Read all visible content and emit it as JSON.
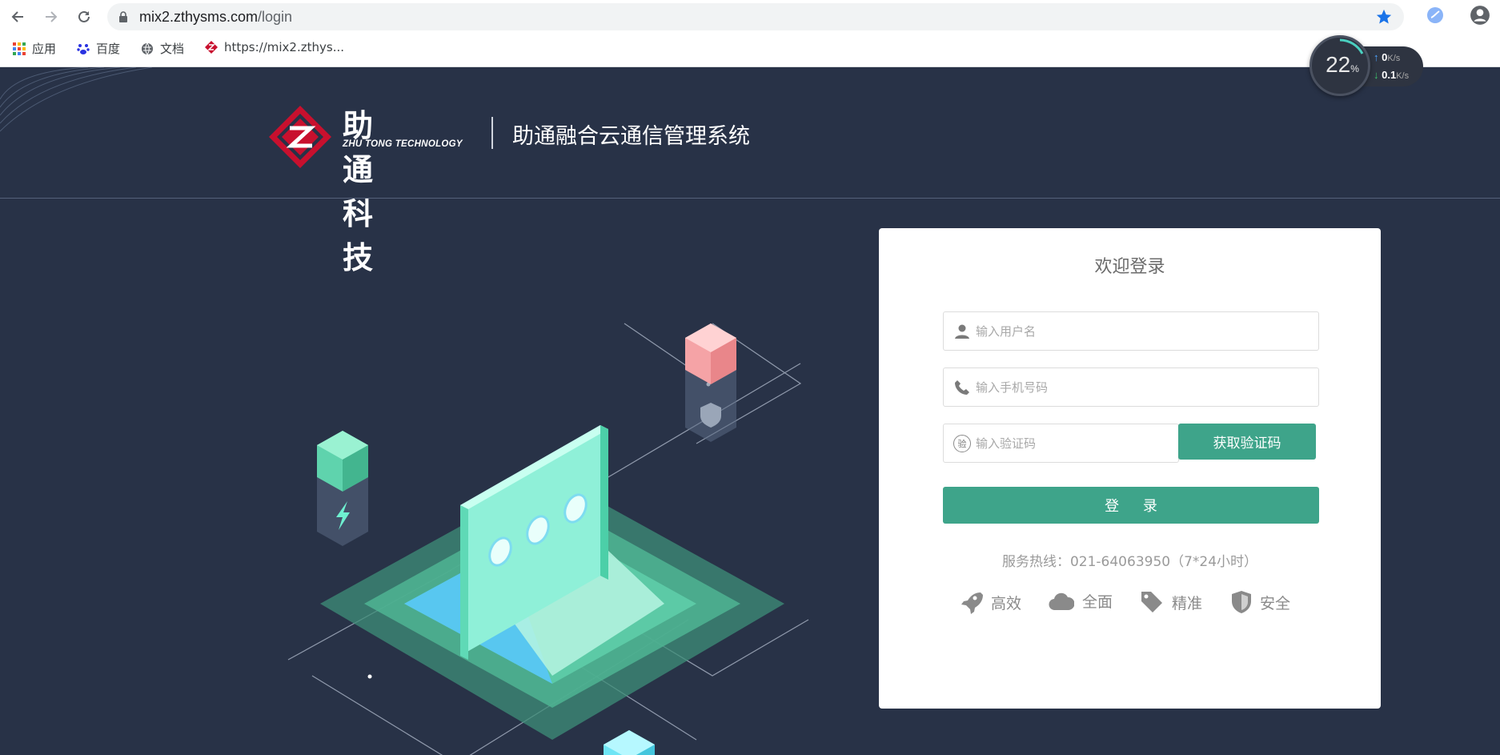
{
  "browser": {
    "url_host": "mix2.zthysms.com",
    "url_path": "/login",
    "bookmarks": [
      {
        "label": "应用",
        "icon": "apps-grid-icon"
      },
      {
        "label": "百度",
        "icon": "baidu-paw-icon"
      },
      {
        "label": "文档",
        "icon": "globe-icon"
      },
      {
        "label": "https://mix2.zthys...",
        "icon": "zhutong-logo-icon"
      }
    ]
  },
  "speed_widget": {
    "percent": "22",
    "percent_unit": "%",
    "upload": "0",
    "download": "0.1",
    "unit": "K/s"
  },
  "header": {
    "brand_cn": "助通科技",
    "brand_en": "ZHU TONG TECHNOLOGY",
    "system_title": "助通融合云通信管理系统"
  },
  "login": {
    "welcome": "欢迎登录",
    "username_placeholder": "输入用户名",
    "phone_placeholder": "输入手机号码",
    "code_placeholder": "输入验证码",
    "code_icon_char": "验",
    "get_code_label": "获取验证码",
    "login_label": "登 录",
    "hotline": "服务热线：021-64063950（7*24小时）",
    "features": [
      {
        "label": "高效",
        "icon": "rocket-icon"
      },
      {
        "label": "全面",
        "icon": "cloud-icon"
      },
      {
        "label": "精准",
        "icon": "tag-icon"
      },
      {
        "label": "安全",
        "icon": "shield-icon"
      }
    ]
  },
  "colors": {
    "page_bg": "#283247",
    "accent": "#3ea48a",
    "brand_red": "#c8102e"
  }
}
